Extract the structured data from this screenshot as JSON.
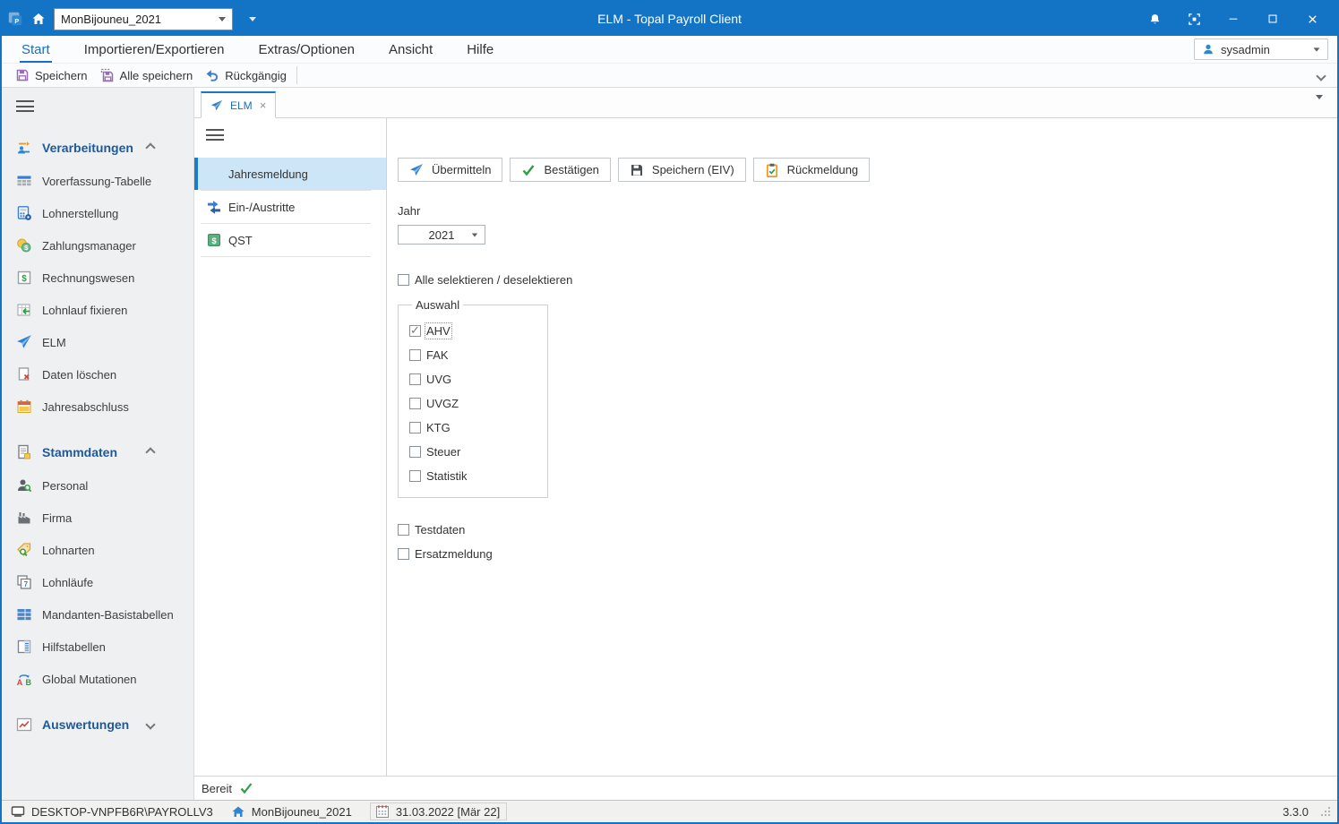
{
  "titlebar": {
    "title": "ELM - Topal Payroll Client",
    "client_selector": "MonBijouneu_2021"
  },
  "menubar": {
    "tabs": [
      {
        "label": "Start",
        "active": true
      },
      {
        "label": "Importieren/Exportieren",
        "active": false
      },
      {
        "label": "Extras/Optionen",
        "active": false
      },
      {
        "label": "Ansicht",
        "active": false
      },
      {
        "label": "Hilfe",
        "active": false
      }
    ],
    "user": "sysadmin"
  },
  "toolbar": {
    "save": "Speichern",
    "save_all": "Alle speichern",
    "undo": "Rückgängig"
  },
  "sidebar": {
    "sections": [
      {
        "label": "Verarbeitungen",
        "collapsed": false,
        "items": [
          {
            "label": "Vorerfassung-Tabelle"
          },
          {
            "label": "Lohnerstellung"
          },
          {
            "label": "Zahlungsmanager"
          },
          {
            "label": "Rechnungswesen"
          },
          {
            "label": "Lohnlauf fixieren"
          },
          {
            "label": "ELM"
          },
          {
            "label": "Daten löschen"
          },
          {
            "label": "Jahresabschluss"
          }
        ]
      },
      {
        "label": "Stammdaten",
        "collapsed": false,
        "items": [
          {
            "label": "Personal"
          },
          {
            "label": "Firma"
          },
          {
            "label": "Lohnarten"
          },
          {
            "label": "Lohnläufe"
          },
          {
            "label": "Mandanten-Basistabellen"
          },
          {
            "label": "Hilfstabellen"
          },
          {
            "label": "Global Mutationen"
          }
        ]
      },
      {
        "label": "Auswertungen",
        "collapsed": true,
        "items": []
      }
    ]
  },
  "tabstrip": {
    "tabs": [
      {
        "label": "ELM"
      }
    ],
    "close_glyph": "×"
  },
  "navpanel": {
    "items": [
      {
        "label": "Jahresmeldung",
        "selected": true
      },
      {
        "label": "Ein-/Austritte",
        "selected": false
      },
      {
        "label": "QST",
        "selected": false
      }
    ]
  },
  "content": {
    "buttons": [
      {
        "label": "Übermitteln"
      },
      {
        "label": "Bestätigen"
      },
      {
        "label": "Speichern (EIV)"
      },
      {
        "label": "Rückmeldung"
      }
    ],
    "jahr": {
      "label": "Jahr",
      "value": "2021"
    },
    "select_all": {
      "label": "Alle selektieren / deselektieren",
      "checked": false
    },
    "auswahl": {
      "legend": "Auswahl",
      "options": [
        {
          "label": "AHV",
          "checked": true,
          "focused": true
        },
        {
          "label": "FAK",
          "checked": false
        },
        {
          "label": "UVG",
          "checked": false
        },
        {
          "label": "UVGZ",
          "checked": false
        },
        {
          "label": "KTG",
          "checked": false
        },
        {
          "label": "Steuer",
          "checked": false
        },
        {
          "label": "Statistik",
          "checked": false
        }
      ]
    },
    "extras": [
      {
        "label": "Testdaten",
        "checked": false
      },
      {
        "label": "Ersatzmeldung",
        "checked": false
      }
    ],
    "status": "Bereit"
  },
  "statusbar": {
    "machine": "DESKTOP-VNPFB6R\\PAYROLLV3",
    "client": "MonBijouneu_2021",
    "date": "31.03.2022 [Mär 22]",
    "version": "3.3.0"
  },
  "colors": {
    "titlebar_blue": "#1373c5",
    "accent_blue": "#1f7ac9",
    "selected_item_bg": "#cde6f7",
    "success_green": "#2f9e3f",
    "save_purple": "#9b6bb3",
    "clipboard_orange": "#e8992e"
  }
}
